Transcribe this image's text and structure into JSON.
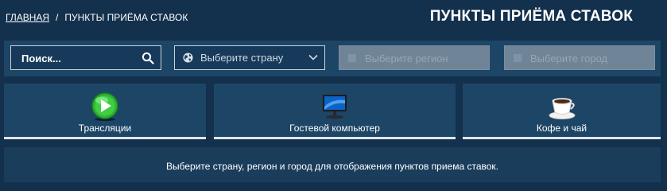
{
  "breadcrumb": {
    "home": "ГЛАВНАЯ",
    "separator": "/",
    "current": "ПУНКТЫ ПРИЁМА СТАВОК"
  },
  "page": {
    "title": "ПУНКТЫ ПРИЁМА СТАВОК"
  },
  "filters": {
    "search_placeholder": "Поиск...",
    "country_placeholder": "Выберите страну",
    "region_placeholder": "Выберите регион",
    "city_placeholder": "Выберите город"
  },
  "services": [
    {
      "label": "Трансляции",
      "icon": "play-icon"
    },
    {
      "label": "Гостевой компьютер",
      "icon": "monitor-icon"
    },
    {
      "label": "Кофе и чай",
      "icon": "coffee-cup-icon"
    }
  ],
  "info": {
    "message": "Выберите страну, регион и город для отображения пунктов приема ставок."
  },
  "colors": {
    "background": "#13304d",
    "panel": "#1d4566",
    "disabled": "#6f8496",
    "play_green": "#2fb232"
  }
}
